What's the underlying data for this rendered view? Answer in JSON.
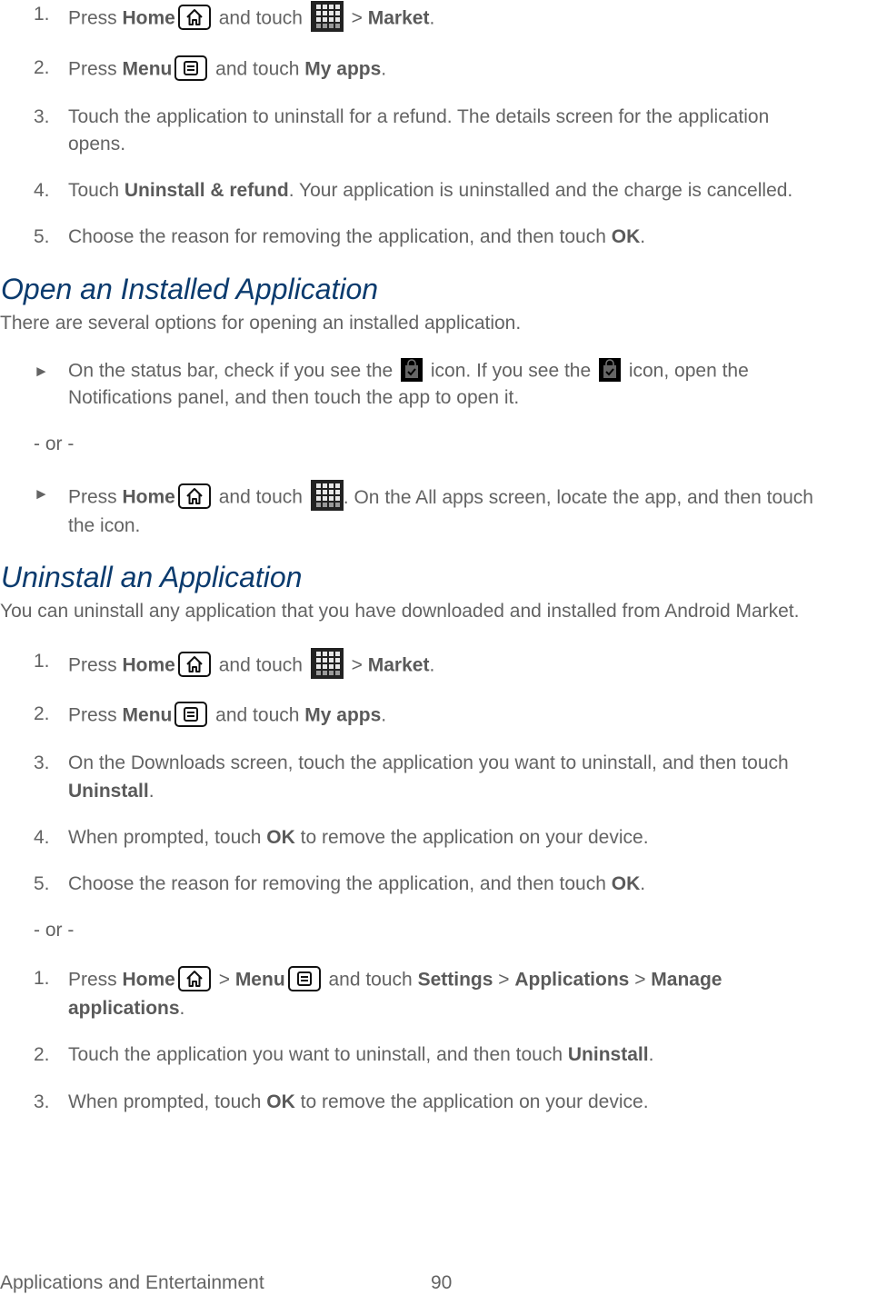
{
  "steps_refund": [
    {
      "num": "1.",
      "parts": [
        "Press ",
        "Home",
        " and touch ",
        " > ",
        "Market",
        "."
      ]
    },
    {
      "num": "2.",
      "parts": [
        "Press ",
        "Menu",
        " and touch ",
        "My apps",
        "."
      ]
    },
    {
      "num": "3.",
      "line1": "Touch the application to uninstall for a refund. The details screen for the application",
      "line2": "opens."
    },
    {
      "num": "4.",
      "parts": [
        "Touch ",
        "Uninstall & refund",
        ". Your application is uninstalled and the charge is cancelled."
      ]
    },
    {
      "num": "5.",
      "parts": [
        "Choose the reason for removing the application, and then touch ",
        "OK",
        "."
      ]
    }
  ],
  "section_open": {
    "heading": "Open an Installed Application",
    "intro": "There are several options for opening an installed application.",
    "bullet1": {
      "a": "On the status bar, check if you see the ",
      "b": " icon. If you see the ",
      "c": " icon, open the",
      "line2": "Notifications panel, and then touch the app to open it."
    },
    "or": "- or -",
    "bullet2": {
      "a": "Press ",
      "home": "Home",
      "b": " and touch ",
      "c": ". On the All apps screen, locate the app, and then touch",
      "line2": "the icon."
    }
  },
  "section_uninstall": {
    "heading": "Uninstall an Application",
    "intro": "You can uninstall any application that you have downloaded and installed from Android Market.",
    "steps": [
      {
        "num": "1.",
        "parts": [
          "Press ",
          "Home",
          " and touch ",
          " > ",
          "Market",
          "."
        ]
      },
      {
        "num": "2.",
        "parts": [
          "Press ",
          "Menu",
          " and touch ",
          "My apps",
          "."
        ]
      },
      {
        "num": "3.",
        "line1": "On the Downloads screen, touch the application you want to uninstall, and then touch",
        "line2_bold": "Uninstall",
        "line2_end": "."
      },
      {
        "num": "4.",
        "parts": [
          "When prompted, touch ",
          "OK",
          " to remove the application on your device."
        ]
      },
      {
        "num": "5.",
        "parts": [
          "Choose the reason for removing the application, and then touch ",
          "OK",
          "."
        ]
      }
    ],
    "or": "- or -",
    "alt_steps": [
      {
        "num": "1.",
        "parts": [
          "Press ",
          "Home",
          " > ",
          "Menu",
          " and touch ",
          "Settings",
          " > ",
          "Applications",
          " > ",
          "Manage"
        ],
        "line2_bold": "applications",
        "line2_end": "."
      },
      {
        "num": "2.",
        "parts": [
          "Touch the application you want to uninstall, and then touch ",
          "Uninstall",
          "."
        ]
      },
      {
        "num": "3.",
        "parts": [
          "When prompted, touch ",
          "OK",
          " to remove the application on your device."
        ]
      }
    ]
  },
  "icons": {
    "home": "home-icon",
    "menu": "menu-icon",
    "apps": "all-apps-grid-icon",
    "market_bag": "market-bag-check-icon"
  },
  "footer": {
    "section": "Applications and Entertainment",
    "page": "90"
  },
  "colors": {
    "heading": "#0b3b6e",
    "text": "#636363"
  }
}
